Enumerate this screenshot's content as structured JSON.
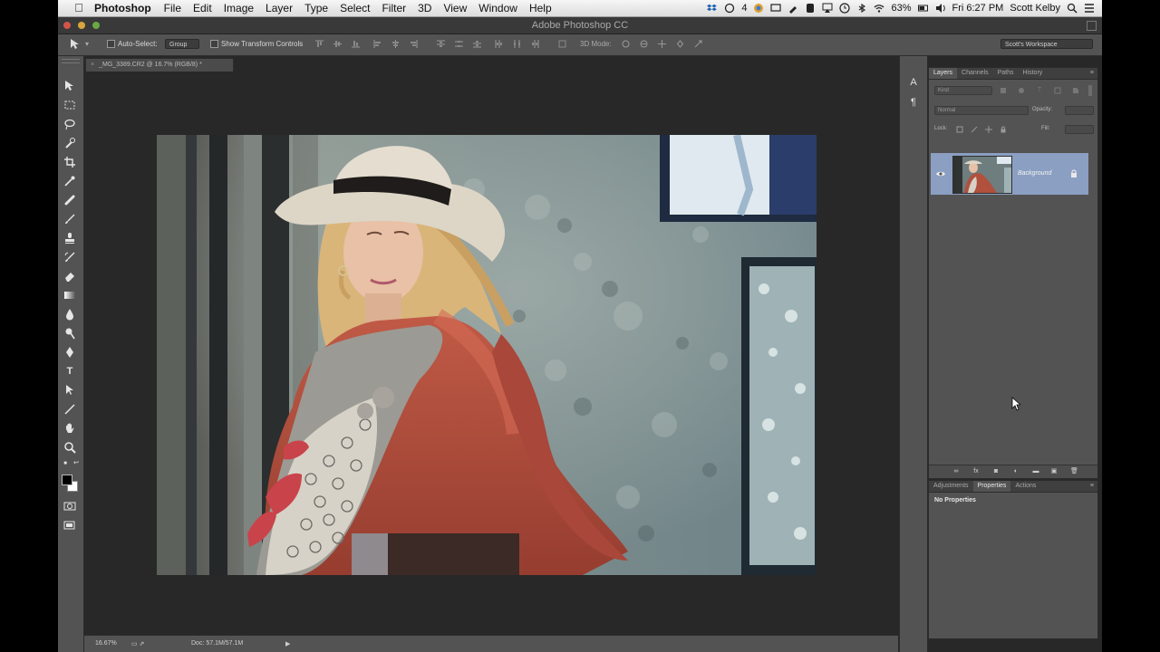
{
  "menubar": {
    "app_name": "Photoshop",
    "items": [
      "File",
      "Edit",
      "Image",
      "Layer",
      "Type",
      "Select",
      "Filter",
      "3D",
      "View",
      "Window",
      "Help"
    ],
    "status": {
      "notification_count": "4",
      "battery": "63%",
      "clock": "Fri 6:27 PM",
      "user": "Scott Kelby"
    }
  },
  "window": {
    "title": "Adobe Photoshop CC"
  },
  "options_bar": {
    "auto_select_label": "Auto-Select:",
    "auto_select_value": "Group",
    "transform_controls_label": "Show Transform Controls",
    "mode_3d_label": "3D Mode:",
    "workspace": "Scott's Workspace"
  },
  "document": {
    "tab_title": "_MG_3389.CR2 @ 16.7% (RGB/8) *",
    "zoom": "16.67%",
    "doc_info": "Doc: 57.1M/57.1M"
  },
  "panels": {
    "layers_tabs": [
      "Layers",
      "Channels",
      "Paths",
      "History"
    ],
    "kind_filter": "Kind",
    "blend_mode": "Normal",
    "opacity_label": "Opacity:",
    "lock_label": "Lock:",
    "fill_label": "Fill:",
    "layer_name": "Background",
    "lower_tabs": [
      "Adjustments",
      "Properties",
      "Actions"
    ],
    "properties_text": "No Properties"
  },
  "colors": {
    "ui_dark": "#282828",
    "panel_gray": "#535353",
    "layer_selected": "#8b9fc2",
    "sweater": "#b0503d"
  },
  "icons": [
    "apple-icon",
    "move-tool-icon",
    "marquee-tool-icon",
    "lasso-tool-icon",
    "quick-selection-icon",
    "crop-tool-icon",
    "eyedropper-icon",
    "healing-brush-icon",
    "brush-tool-icon",
    "clone-stamp-icon",
    "history-brush-icon",
    "eraser-icon",
    "gradient-tool-icon",
    "blur-tool-icon",
    "dodge-tool-icon",
    "pen-tool-icon",
    "type-tool-icon",
    "path-selection-icon",
    "line-tool-icon",
    "hand-tool-icon",
    "zoom-tool-icon",
    "eye-icon",
    "lock-icon",
    "mouse-pointer-icon"
  ]
}
